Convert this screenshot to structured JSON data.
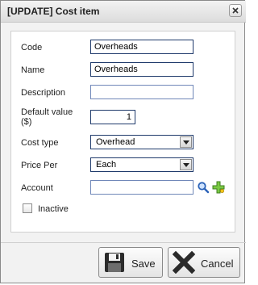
{
  "window": {
    "title": "[UPDATE] Cost item"
  },
  "form": {
    "code": {
      "label": "Code",
      "value": "Overheads"
    },
    "name": {
      "label": "Name",
      "value": "Overheads"
    },
    "description": {
      "label": "Description",
      "value": ""
    },
    "default_value": {
      "label_line1": "Default value",
      "label_line2": "($)",
      "value": "1"
    },
    "cost_type": {
      "label": "Cost type",
      "selected": "Overhead"
    },
    "price_per": {
      "label": "Price Per",
      "selected": "Each"
    },
    "account": {
      "label": "Account",
      "value": ""
    },
    "inactive": {
      "label": "Inactive",
      "checked": false
    }
  },
  "buttons": {
    "save": "Save",
    "cancel": "Cancel"
  },
  "icons": {
    "close": "close-icon",
    "search": "search-icon",
    "add": "add-icon",
    "save": "floppy-disk-icon",
    "cancel": "x-icon"
  }
}
